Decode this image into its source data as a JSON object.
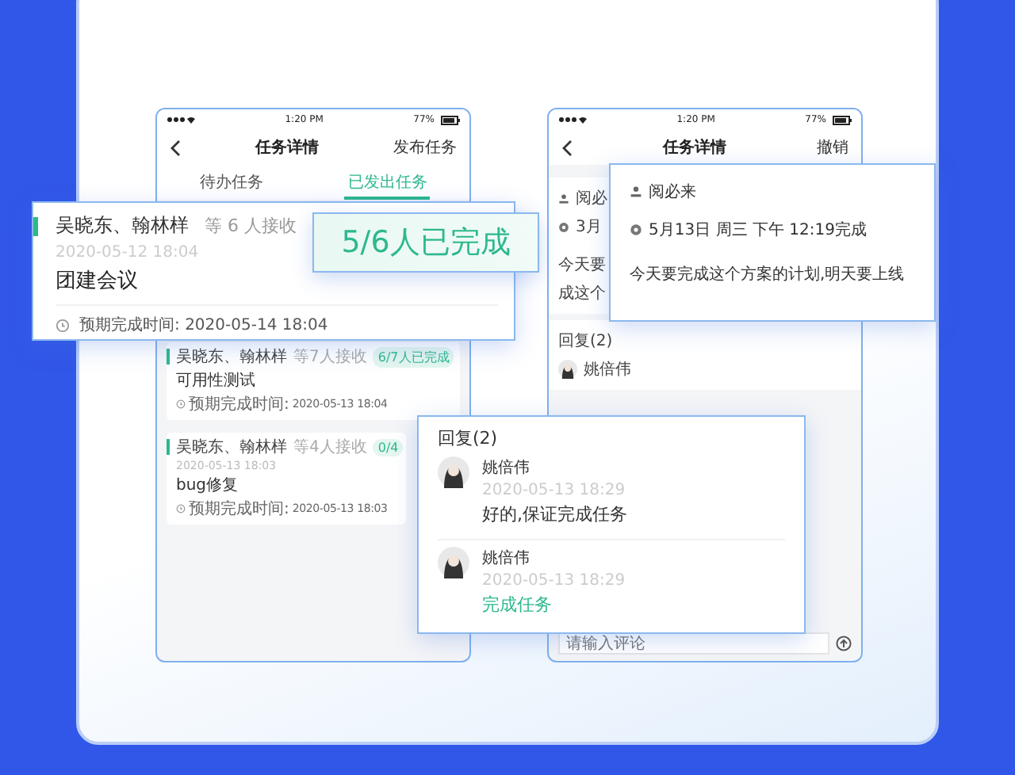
{
  "phones": [
    {
      "kind": "list",
      "status": {
        "time": "1:20 PM",
        "battery": "77%"
      },
      "title": "任务详情",
      "action": "发布任务",
      "tabs": [
        {
          "label": "待办任务",
          "selected": false
        },
        {
          "label": "已发出任务",
          "selected": true
        }
      ],
      "tasks": [
        {
          "receivers": "吴晓东、翰林样",
          "count": "等7人接收",
          "progress": "6/7人已完成",
          "title": "可用性测试",
          "due_label": "预期完成时间:",
          "due": "2020-05-13 18:04"
        },
        {
          "receivers": "吴晓东、翰林样",
          "count": "等4人接收",
          "date": "2020-05-13 18:03",
          "progress": "0/4",
          "title": "bug修复",
          "due_label": "预期完成时间:",
          "due": "2020-05-13 18:03"
        }
      ]
    },
    {
      "kind": "detail",
      "status": {
        "time": "1:20 PM",
        "battery": "77%"
      },
      "title": "任务详情",
      "action": "撤销",
      "assignee": "阅必",
      "time": "3月",
      "body": [
        "今天要",
        "成这个"
      ],
      "replies_label": "回复(2)",
      "reply_name": "姚倍伟",
      "placeholder": "请输入评论"
    }
  ],
  "task_card": {
    "receivers": "吴晓东、翰林样",
    "count": "等 6 人接收",
    "date": "2020-05-12 18:04",
    "title": "团建会议",
    "due_label": "预期完成时间:",
    "due": "2020-05-14 18:04"
  },
  "badge": "5/6人已完成",
  "detail_card": {
    "assignee": "阅必来",
    "time": "5月13日 周三 下午 12:19完成",
    "body": "今天要完成这个方案的计划,明天要上线"
  },
  "replies_card": {
    "label": "回复(2)",
    "replies": [
      {
        "name": "姚倍伟",
        "time": "2020-05-13 18:29",
        "text": "好的,保证完成任务",
        "highlighted": false
      },
      {
        "name": "姚倍伟",
        "time": "2020-05-13 18:29",
        "text": "完成任务",
        "highlighted": true
      }
    ]
  }
}
